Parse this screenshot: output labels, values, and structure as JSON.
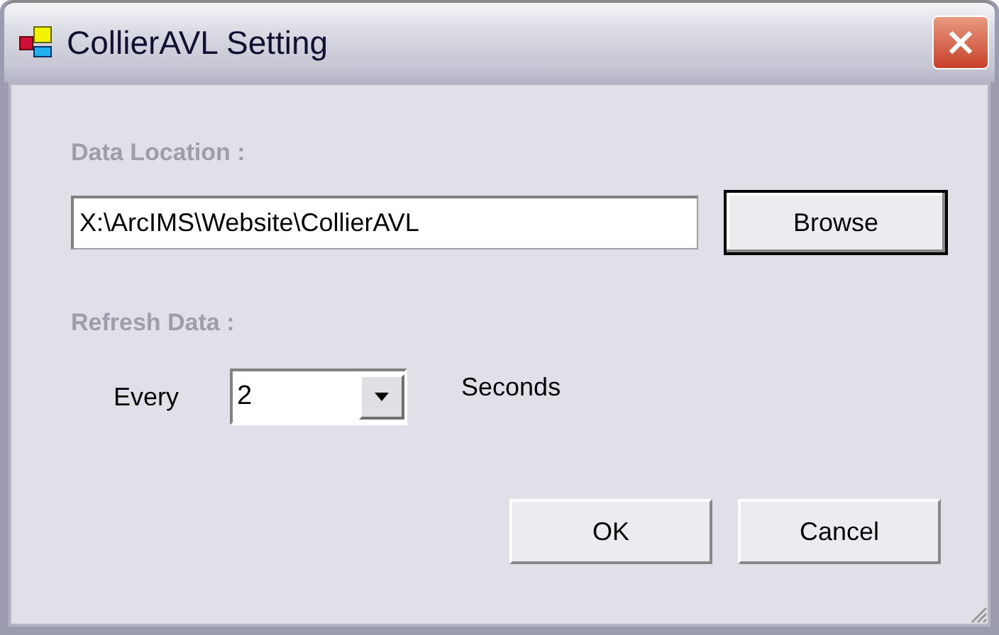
{
  "window": {
    "title": "CollierAVL Setting"
  },
  "data_location": {
    "label": "Data Location :",
    "disabled": true,
    "value": "X:\\ArcIMS\\Website\\CollierAVL"
  },
  "refresh": {
    "label": "Refresh Data :",
    "disabled": true,
    "prefix": "Every",
    "value": "2",
    "suffix": "Seconds"
  },
  "browse_button": {
    "label": "Browse",
    "default": true
  },
  "buttons": [
    {
      "label": "OK",
      "default": false
    },
    {
      "label": "Cancel",
      "default": false
    }
  ]
}
